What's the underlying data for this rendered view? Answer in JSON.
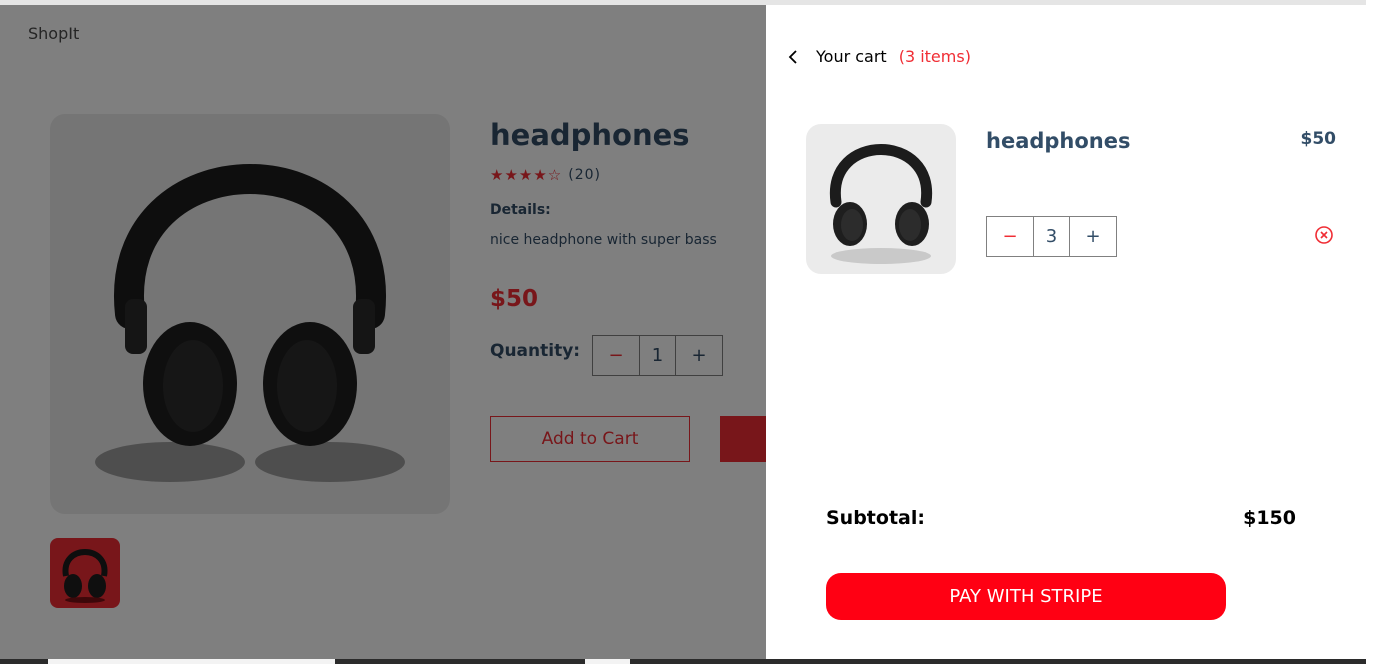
{
  "app": {
    "logo": "ShopIt"
  },
  "product": {
    "title": "headphones",
    "stars": "★★★★☆",
    "review_count": "(20)",
    "details_heading": "Details:",
    "description": "nice headphone with super bass",
    "price": "$50",
    "quantity_label": "Quantity:",
    "quantity": "1",
    "minus": "−",
    "plus": "+",
    "add_to_cart": "Add to Cart"
  },
  "cart": {
    "back_icon": "chevron-left-icon",
    "title": "Your cart",
    "count": "(3 items)",
    "items": [
      {
        "name": "headphones",
        "price": "$50",
        "quantity": "3",
        "minus": "−",
        "plus": "+",
        "remove_icon": "remove-circle-icon"
      }
    ],
    "subtotal_label": "Subtotal:",
    "subtotal_value": "$150",
    "pay_button": "PAY WITH STRIPE"
  },
  "colors": {
    "accent": "#f02d34",
    "text": "#324d67",
    "pay_button": "#ff0013"
  }
}
